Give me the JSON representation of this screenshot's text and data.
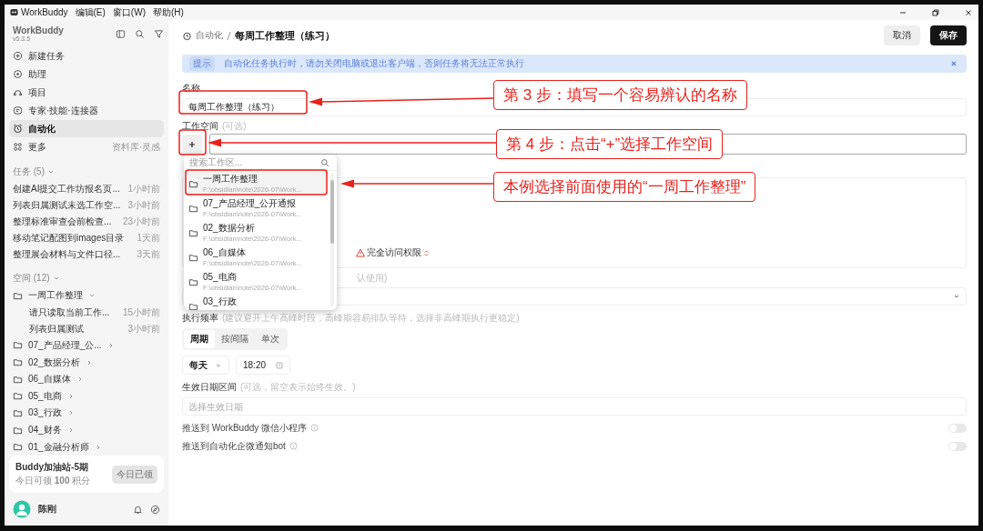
{
  "menubar": {
    "app": "WorkBuddy",
    "menus": [
      "编辑(E)",
      "窗口(W)",
      "帮助(H)"
    ]
  },
  "sidebar": {
    "app_name": "WorkBuddy",
    "version": "v5.3.5",
    "nav": [
      {
        "label": "新建任务",
        "selected": false
      },
      {
        "label": "助理",
        "selected": false
      },
      {
        "label": "项目",
        "selected": false
      },
      {
        "label": "专家·技能·连接器",
        "selected": false
      },
      {
        "label": "自动化",
        "selected": true
      },
      {
        "label": "更多",
        "selected": false,
        "hint": "资料库·灵感"
      }
    ],
    "tasks_header": "任务 (5)",
    "tasks": [
      {
        "title": "创建AI提交工作坊报名页...",
        "time": "1小时前"
      },
      {
        "title": "列表归属测试未选工作空...",
        "time": "3小时前"
      },
      {
        "title": "整理标准审查会前检查...",
        "time": "23小时前"
      },
      {
        "title": "移动笔记配图到images目录",
        "time": "1天前"
      },
      {
        "title": "整理展会材料与文件口径...",
        "time": "3天前"
      }
    ],
    "spaces_header": "空间 (12)",
    "spaces": [
      {
        "name": "一周工作整理",
        "expanded": true,
        "children": [
          {
            "title": "请只读取当前工作...",
            "time": "15小时前"
          },
          {
            "title": "列表归属测试",
            "time": "3小时前"
          }
        ]
      },
      {
        "name": "07_产品经理_公...",
        "expanded": false
      },
      {
        "name": "02_数据分析",
        "expanded": false
      },
      {
        "name": "06_自媒体",
        "expanded": false
      },
      {
        "name": "05_电商",
        "expanded": false
      },
      {
        "name": "03_行政",
        "expanded": false
      },
      {
        "name": "04_财务",
        "expanded": false
      },
      {
        "name": "01_金融分析师",
        "expanded": false
      }
    ],
    "promo": {
      "title": "Buddy加油站-5期",
      "text": "今日可领 **100** 积分",
      "button": "今日已领",
      "button_disabled": true
    },
    "user": {
      "name": "陈刚"
    }
  },
  "main": {
    "breadcrumb": {
      "parent": "自动化",
      "current": "每周工作整理（练习）"
    },
    "buttons": [
      {
        "label": "取消",
        "kind": "secondary"
      },
      {
        "label": "保存",
        "kind": "primary"
      }
    ],
    "notice": {
      "badge": "提示",
      "text": "自动化任务执行时，请勿关闭电脑或退出客户端，否则任务将无法正常执行"
    },
    "name_label": "名称",
    "name_value": "每周工作整理（练习）",
    "workspace_label": "工作空间",
    "workspace_hint": "(可选)",
    "permission": "完全访问权限",
    "model_hint": "认使用)",
    "frequency_label": "执行频率",
    "frequency_hint": "(建议避开上午高峰时段，高峰期容易排队等待，选择非高峰期执行更稳定)",
    "frequency_tabs": [
      {
        "label": "周期",
        "selected": true
      },
      {
        "label": "按间隔",
        "selected": false
      },
      {
        "label": "单次",
        "selected": false
      }
    ],
    "repeat": "每天",
    "time": "18:20",
    "date_label": "生效日期区间",
    "date_hint": "(可选，留空表示始终生效。)",
    "date_placeholder": "选择生效日期",
    "toggles": [
      {
        "label": "推送到 WorkBuddy 微信小程序",
        "on": false
      },
      {
        "label": "推送到自动化企微通知bot",
        "on": false
      }
    ],
    "dropdown": {
      "placeholder": "搜索工作区...",
      "items": [
        {
          "name": "一周工作整理",
          "path": "F:\\obsidian\\note\\2026-07\\Work...",
          "selected": true
        },
        {
          "name": "07_产品经理_公开通报",
          "path": "F:\\obsidian\\note\\2026-07\\Work...",
          "selected": false
        },
        {
          "name": "02_数据分析",
          "path": "F:\\obsidian\\note\\2026-07\\Work...",
          "selected": false
        },
        {
          "name": "06_自媒体",
          "path": "F:\\obsidian\\note\\2026-07\\Work...",
          "selected": false
        },
        {
          "name": "05_电商",
          "path": "F:\\obsidian\\note\\2026-07\\Work...",
          "selected": false
        },
        {
          "name": "03_行政",
          "selected": false
        }
      ]
    }
  },
  "annotations": [
    {
      "text": "第 3 步：填写一个容易辨认的名称"
    },
    {
      "text": "第 4 步：点击“+”选择工作空间"
    },
    {
      "text": "本例选择前面使用的“一周工作整理”"
    }
  ]
}
